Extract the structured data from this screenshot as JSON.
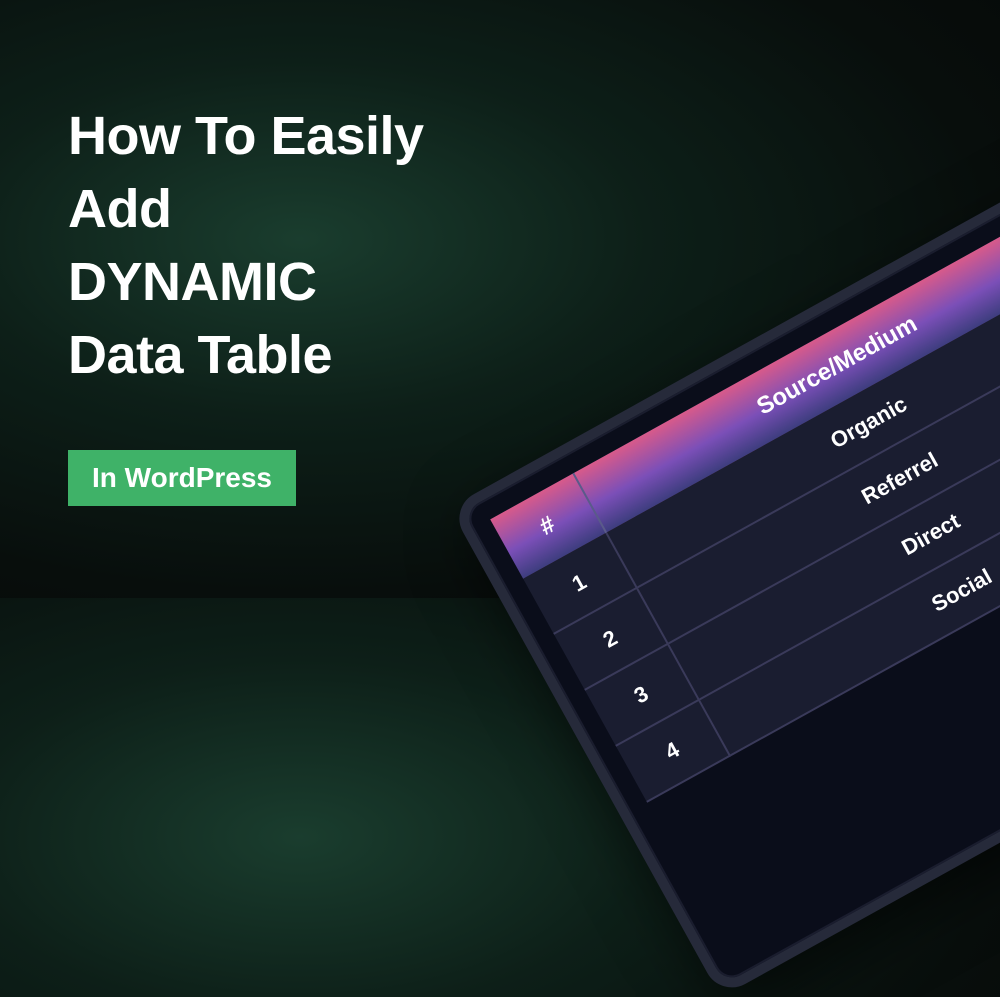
{
  "headline": {
    "line1": "How To Easily",
    "line2": "Add",
    "line3": "DYNAMIC",
    "line4": "Data Table"
  },
  "badge": {
    "label": "In WordPress"
  },
  "table": {
    "headers": {
      "number": "#",
      "source": "Source/Medium"
    },
    "rows": [
      {
        "num": "1",
        "source": "Organic"
      },
      {
        "num": "2",
        "source": "Referrel"
      },
      {
        "num": "3",
        "source": "Direct"
      },
      {
        "num": "4",
        "source": "Social"
      }
    ]
  },
  "colors": {
    "accent_green": "#3fb268",
    "gradient_pink": "#d85a8a",
    "gradient_purple": "#3d3d7e"
  }
}
